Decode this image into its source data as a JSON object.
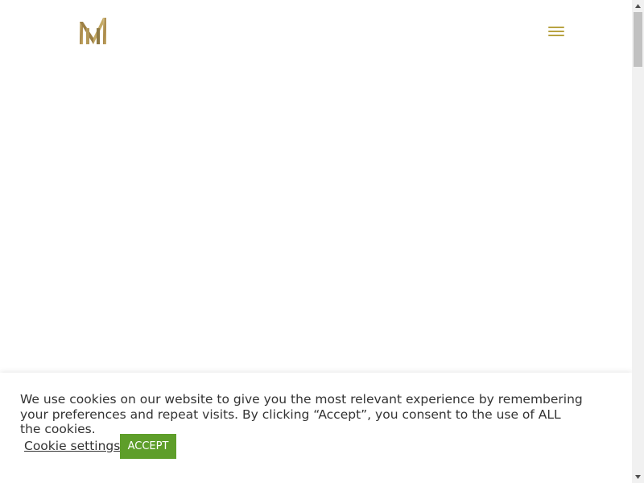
{
  "colors": {
    "accent_gold": "#b8a342",
    "accept_green": "#5e9e2a",
    "text": "#333333"
  },
  "header": {
    "logo_icon": "monogram-m-logo",
    "menu_icon": "hamburger-menu-icon"
  },
  "cookie_banner": {
    "message": "We use cookies on our website to give you the most relevant experience by remembering your preferences and repeat visits. By clicking “Accept”, you consent to the use of ALL the cookies.",
    "settings_label": "Cookie settings",
    "accept_label": "ACCEPT"
  },
  "scrollbar": {
    "up_icon": "scroll-up-arrow-icon",
    "down_icon": "scroll-down-arrow-icon"
  }
}
